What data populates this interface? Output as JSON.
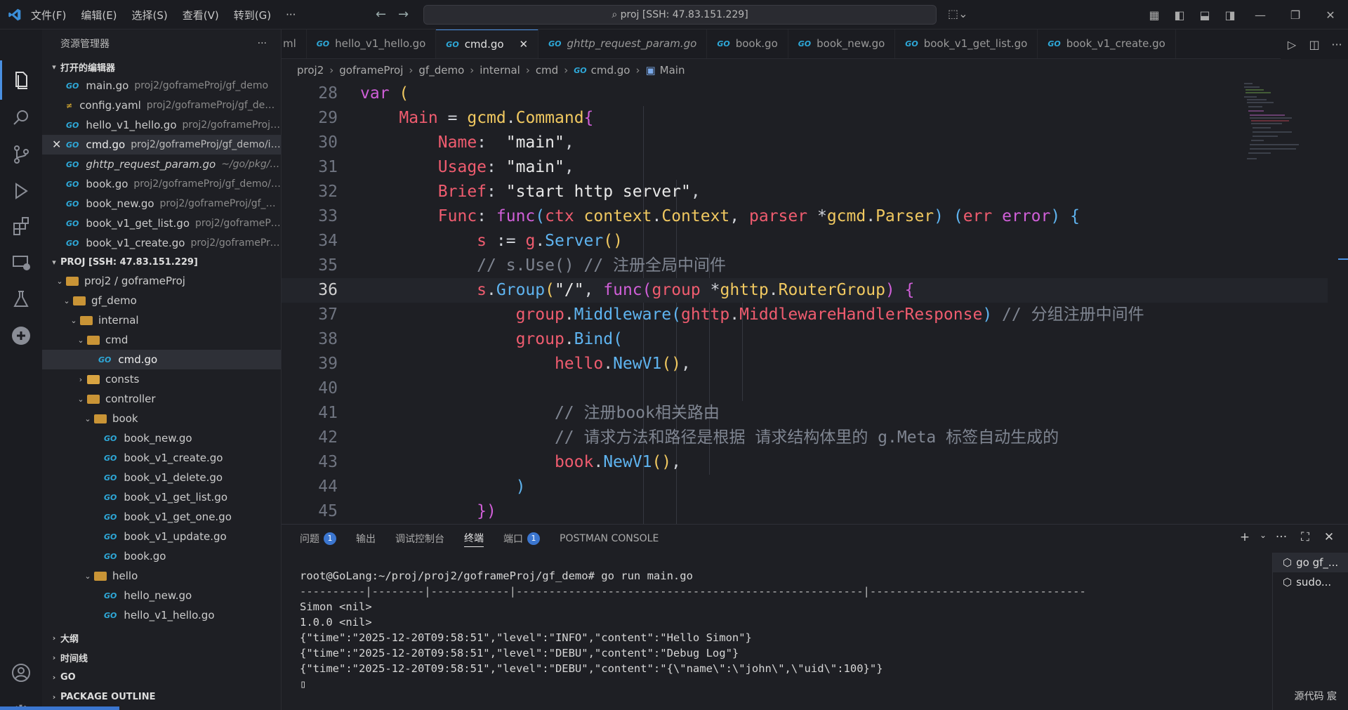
{
  "titlebar": {
    "menus": [
      "文件(F)",
      "编辑(E)",
      "选择(S)",
      "查看(V)",
      "转到(G)",
      "···"
    ],
    "search": "proj [SSH: 47.83.151.229]"
  },
  "sidebar": {
    "header": "资源管理器",
    "more": "···",
    "open_editors_title": "打开的编辑器",
    "open_editors": [
      {
        "name": "main.go",
        "path": "proj2/goframeProj/gf_demo",
        "icon": "go"
      },
      {
        "name": "config.yaml",
        "path": "proj2/goframeProj/gf_dem...",
        "icon": "yaml"
      },
      {
        "name": "hello_v1_hello.go",
        "path": "proj2/goframeProj/g...",
        "icon": "go"
      },
      {
        "name": "cmd.go",
        "path": "proj2/goframeProj/gf_demo/in...",
        "icon": "go"
      },
      {
        "name": "ghttp_request_param.go",
        "path": "~/go/pkg/mo...",
        "icon": "go"
      },
      {
        "name": "book.go",
        "path": "proj2/goframeProj/gf_demo/a...",
        "icon": "go"
      },
      {
        "name": "book_new.go",
        "path": "proj2/goframeProj/gf_de...",
        "icon": "go"
      },
      {
        "name": "book_v1_get_list.go",
        "path": "proj2/goframePro...",
        "icon": "go"
      },
      {
        "name": "book_v1_create.go",
        "path": "proj2/goframeProj...",
        "icon": "go"
      }
    ],
    "proj_title": "PROJ [SSH: 47.83.151.229]",
    "tree": [
      {
        "label": "proj2 / goframeProj",
        "type": "folder"
      },
      {
        "label": "gf_demo",
        "type": "folder"
      },
      {
        "label": "internal",
        "type": "folder"
      },
      {
        "label": "cmd",
        "type": "folder"
      },
      {
        "label": "cmd.go",
        "type": "go"
      },
      {
        "label": "consts",
        "type": "folder"
      },
      {
        "label": "controller",
        "type": "folder"
      },
      {
        "label": "book",
        "type": "folder"
      },
      {
        "label": "book_new.go",
        "type": "go"
      },
      {
        "label": "book_v1_create.go",
        "type": "go"
      },
      {
        "label": "book_v1_delete.go",
        "type": "go"
      },
      {
        "label": "book_v1_get_list.go",
        "type": "go"
      },
      {
        "label": "book_v1_get_one.go",
        "type": "go"
      },
      {
        "label": "book_v1_update.go",
        "type": "go"
      },
      {
        "label": "book.go",
        "type": "go"
      },
      {
        "label": "hello",
        "type": "folder"
      },
      {
        "label": "hello_new.go",
        "type": "go"
      },
      {
        "label": "hello_v1_hello.go",
        "type": "go"
      }
    ],
    "bottom_sections": [
      "大纲",
      "时间线",
      "GO",
      "PACKAGE OUTLINE"
    ]
  },
  "tabs": [
    "ml",
    "hello_v1_hello.go",
    "cmd.go",
    "ghttp_request_param.go",
    "book.go",
    "book_new.go",
    "book_v1_get_list.go",
    "book_v1_create.go"
  ],
  "breadcrumb": [
    "proj2",
    "goframeProj",
    "gf_demo",
    "internal",
    "cmd",
    "cmd.go",
    "Main"
  ],
  "code": {
    "line_numbers": [
      "28",
      "29",
      "30",
      "31",
      "32",
      "33",
      "34",
      "35",
      "36",
      "37",
      "38",
      "39",
      "40",
      "41",
      "42",
      "43",
      "44",
      "45"
    ],
    "current_line": "36"
  },
  "panel": {
    "tabs": [
      "问题",
      "输出",
      "调试控制台",
      "终端",
      "端口",
      "POSTMAN CONSOLE"
    ],
    "problems_count": "1",
    "ports_count": "1",
    "terminal_lines": [
      "root@GoLang:~/proj/proj2/goframeProj/gf_demo# go run main.go",
      "----------|--------|------------|-----------------------------------------------------|---------------------------------",
      "",
      "Simon <nil>",
      "1.0.0 <nil>",
      "{\"time\":\"2025-12-20T09:58:51\",\"level\":\"INFO\",\"content\":\"Hello Simon\"}",
      "{\"time\":\"2025-12-20T09:58:51\",\"level\":\"DEBU\",\"content\":\"Debug Log\"}",
      "{\"time\":\"2025-12-20T09:58:51\",\"level\":\"DEBU\",\"content\":\"{\\\"name\\\":\\\"john\\\",\\\"uid\\\":100}\"}",
      "▯"
    ],
    "terminals": [
      "go gf_...",
      "sudo..."
    ]
  },
  "status": {
    "right": "源代码  宸"
  }
}
